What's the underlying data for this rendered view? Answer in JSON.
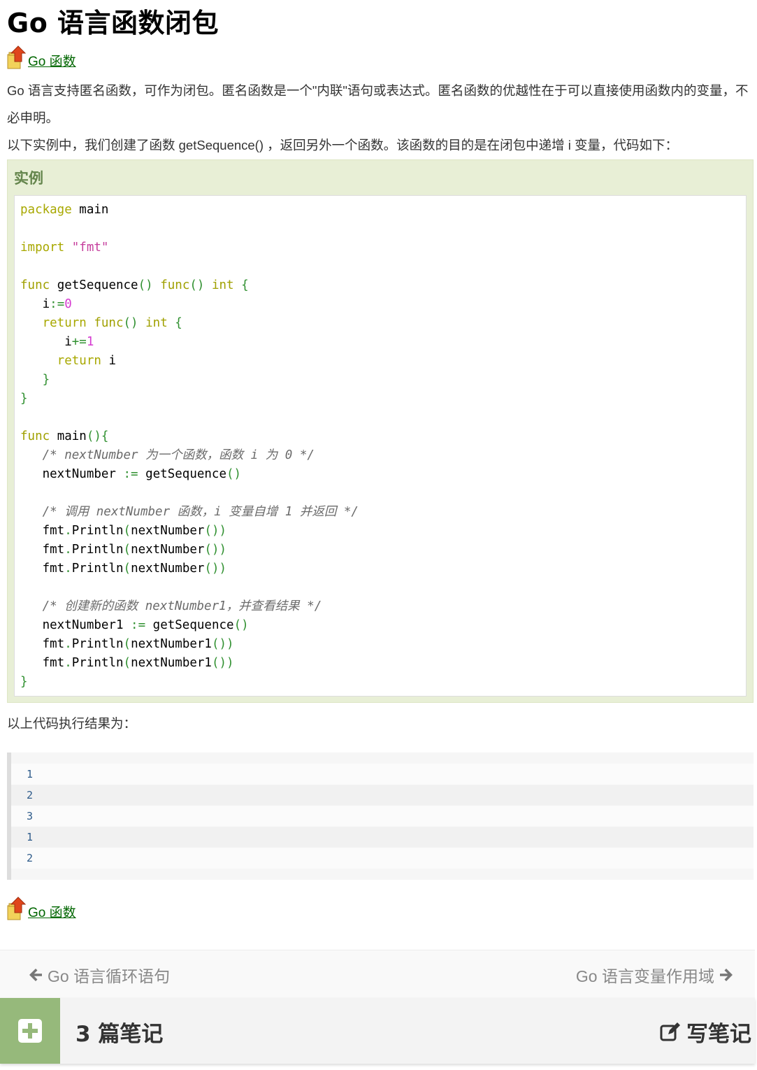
{
  "title": "Go 语言函数闭包",
  "back_link": {
    "label": "Go 函数"
  },
  "intro": [
    "Go 语言支持匿名函数，可作为闭包。匿名函数是一个\"内联\"语句或表达式。匿名函数的优越性在于可以直接使用函数内的变量，不必申明。",
    "以下实例中，我们创建了函数 getSequence() ，返回另外一个函数。该函数的目的是在闭包中递增 i 变量，代码如下："
  ],
  "example": {
    "title": "实例",
    "code": {
      "l1": [
        "package",
        " main"
      ],
      "l2": [
        "import",
        " ",
        "\"fmt\""
      ],
      "l3": [
        "func",
        " getSequence",
        "()",
        " func",
        "()",
        " int",
        " {"
      ],
      "l4": [
        "   i",
        ":=",
        "0"
      ],
      "l5": [
        "   return",
        " func",
        "()",
        " int",
        " {"
      ],
      "l6": [
        "      i",
        "+=",
        "1"
      ],
      "l7": [
        "     return",
        " i"
      ],
      "l8": [
        "   }"
      ],
      "l9": [
        "}"
      ],
      "l10": [
        "func",
        " main",
        "(){"
      ],
      "l11": [
        "   /* nextNumber 为一个函数，函数 i 为 0 */"
      ],
      "l12": [
        "   nextNumber",
        " :=",
        " getSequence",
        "()"
      ],
      "l13": [
        "   /* 调用 nextNumber 函数，i 变量自增 1 并返回 */"
      ],
      "l14": [
        "   fmt",
        ".",
        "Println",
        "(",
        "nextNumber",
        "())"
      ],
      "l15": [
        "   fmt",
        ".",
        "Println",
        "(",
        "nextNumber",
        "())"
      ],
      "l16": [
        "   fmt",
        ".",
        "Println",
        "(",
        "nextNumber",
        "())"
      ],
      "l17": [
        "   /* 创建新的函数 nextNumber1，并查看结果 */"
      ],
      "l18": [
        "   nextNumber1",
        " :=",
        " getSequence",
        "()"
      ],
      "l19": [
        "   fmt",
        ".",
        "Println",
        "(",
        "nextNumber1",
        "())"
      ],
      "l20": [
        "   fmt",
        ".",
        "Println",
        "(",
        "nextNumber1",
        "())"
      ],
      "l21": [
        "}"
      ]
    }
  },
  "result_label": "以上代码执行结果为：",
  "output_lines": [
    "1",
    "2",
    "3",
    "1",
    "2"
  ],
  "nav": {
    "prev_label": "Go 语言循环语句",
    "next_label": "Go 语言变量作用域"
  },
  "notes": {
    "count_label": "3 篇笔记",
    "write_label": "写笔记"
  },
  "colors": {
    "link": "#006600",
    "example_bg": "#e8efd6",
    "example_title": "#64854c",
    "plus_box": "#96b97b"
  },
  "icons": [
    "up-arrow-folder-icon",
    "arrow-left-icon",
    "arrow-right-icon",
    "plus-icon",
    "edit-icon"
  ]
}
